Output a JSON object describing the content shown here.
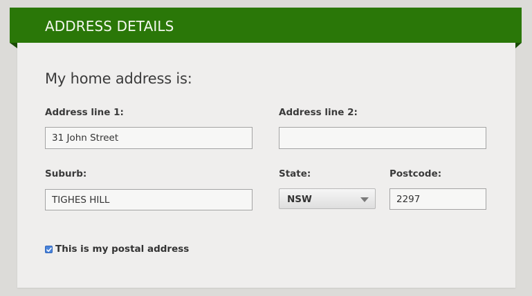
{
  "header": {
    "title": "ADDRESS DETAILS"
  },
  "section": {
    "heading": "My home address is:"
  },
  "fields": {
    "address_line_1": {
      "label": "Address line 1:",
      "value": "31 John Street"
    },
    "address_line_2": {
      "label": "Address line 2:",
      "value": ""
    },
    "suburb": {
      "label": "Suburb:",
      "value": "TIGHES HILL"
    },
    "state": {
      "label": "State:",
      "selected": "NSW"
    },
    "postcode": {
      "label": "Postcode:",
      "value": "2297"
    }
  },
  "postal_checkbox": {
    "label": "This is my postal address",
    "checked": true
  },
  "colors": {
    "header_green": "#2a7708",
    "header_fold": "#1a4c04",
    "card_background": "#efeeed",
    "page_background": "#dcdbd8",
    "checkbox_blue": "#4a84da"
  },
  "icons": {
    "dropdown": "chevron-down-icon",
    "checkbox": "checkmark-icon"
  }
}
